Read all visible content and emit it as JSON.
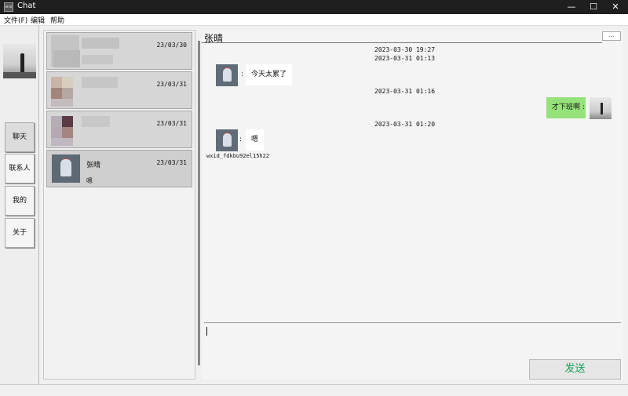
{
  "window": {
    "title": "Chat",
    "app_icon_text": "≡≡",
    "controls": {
      "minimize": "—",
      "maximize": "☐",
      "close": "✕"
    }
  },
  "menu": [
    "文件(F)",
    "编辑",
    "帮助"
  ],
  "nav": {
    "items": [
      {
        "label": "聊天",
        "active": true
      },
      {
        "label": "联系人",
        "active": false
      },
      {
        "label": "我的",
        "active": false
      },
      {
        "label": "关于",
        "active": false
      }
    ]
  },
  "conversations": [
    {
      "name": "",
      "date": "23/03/30",
      "last_message": "",
      "blurred": true
    },
    {
      "name": "",
      "date": "23/03/31",
      "last_message": "",
      "blurred": true
    },
    {
      "name": "",
      "date": "23/03/31",
      "last_message": "",
      "blurred": true
    },
    {
      "name": "张晴",
      "date": "23/03/31",
      "last_message": "嗯",
      "blurred": false,
      "selected": true
    }
  ],
  "chat": {
    "contact_name": "张晴",
    "more_label": "...",
    "timestamps": [
      "2023-03-30 19:27",
      "2023-03-31 01:13",
      "2023-03-31 01:16",
      "2023-03-31 01:20"
    ],
    "messages": [
      {
        "from": "contact",
        "text": "今天太累了"
      },
      {
        "from": "me",
        "text": "才下班啊"
      },
      {
        "from": "contact",
        "text": "嗯"
      }
    ],
    "separator": ":",
    "wxid": "wxid_fdkbu92el15h22",
    "input_value": "",
    "send_label": "发送"
  },
  "colors": {
    "self_bubble": "#96e27a",
    "send_text": "#1aa05a"
  }
}
